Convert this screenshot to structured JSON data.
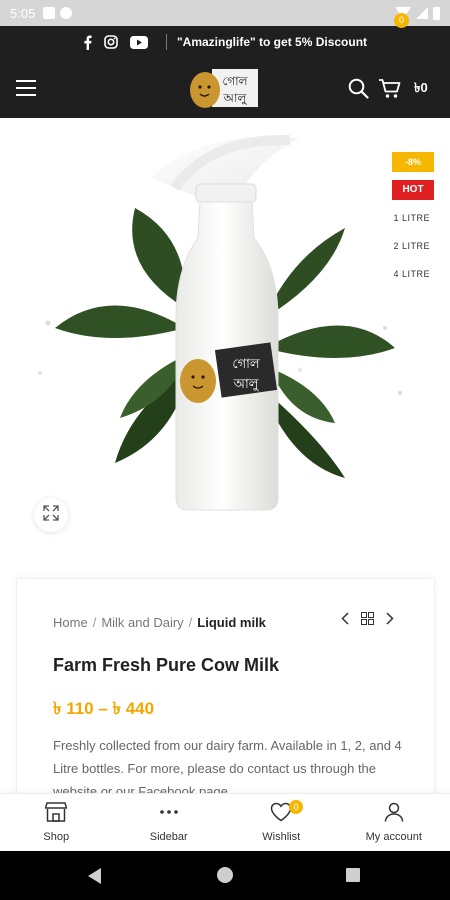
{
  "status_bar": {
    "time": "5:05"
  },
  "top_bar": {
    "promo_text": "\"Amazinglife\" to get 5% Discount"
  },
  "header": {
    "logo_text_top": "গোল",
    "logo_text_bottom": "আলু",
    "cart_count": "0",
    "cart_total": "৳0"
  },
  "product_media": {
    "sale_badge": "-8%",
    "hot_badge": "HOT",
    "variants": [
      "1 LITRE",
      "2 LITRE",
      "4 LITRE"
    ]
  },
  "breadcrumb": {
    "home": "Home",
    "category": "Milk and Dairy",
    "current": "Liquid milk"
  },
  "product": {
    "title": "Farm Fresh Pure Cow Milk",
    "price": "৳ 110 – ৳ 440",
    "description": "Freshly collected from our dairy farm. Available in 1, 2, and 4 Litre bottles. For more, please do contact us through the website or our Facebook page."
  },
  "bottom_nav": {
    "shop": "Shop",
    "sidebar": "Sidebar",
    "wishlist": "Wishlist",
    "wishlist_count": "0",
    "account": "My account"
  },
  "colors": {
    "accent": "#f5b700",
    "hot": "#e02020",
    "dark": "#1f1f1f"
  }
}
